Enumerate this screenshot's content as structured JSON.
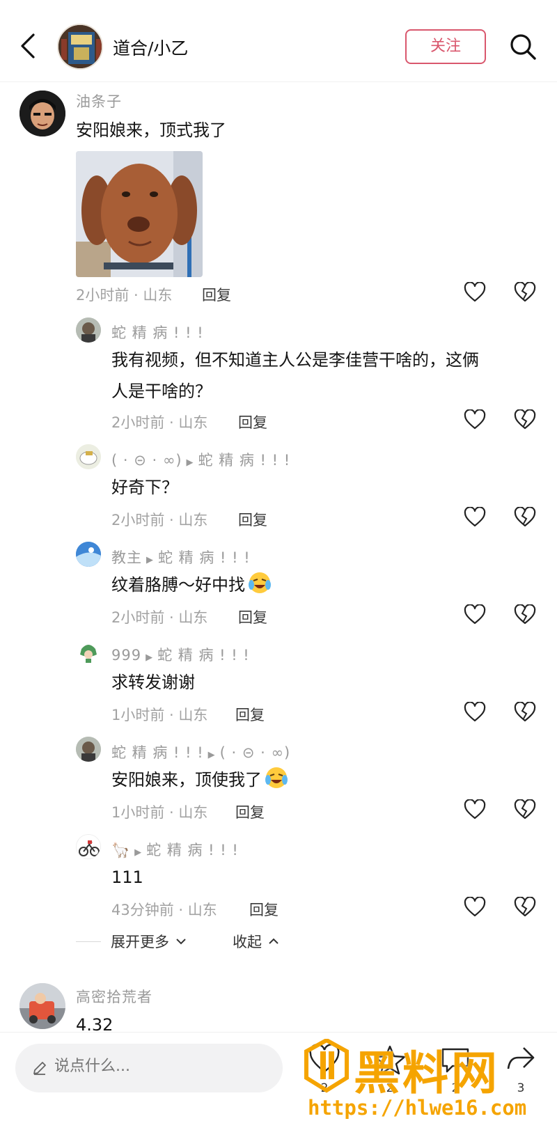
{
  "header": {
    "title": "道合/小乙",
    "follow_label": "关注"
  },
  "comments": [
    {
      "user": "油条子",
      "text": "安阳娘来，顶式我了",
      "time": "2小时前 · 山东",
      "reply": "回复"
    },
    {
      "user": "蛇 精 病 ! ! !",
      "text_line1": "我有视频，但不知道主人公是李佳营干啥的，这俩",
      "text_line2": "人是干啥的？",
      "time": "2小时前 · 山东",
      "reply": "回复"
    },
    {
      "user": "( · ⊝ · ∞)",
      "reply_to": "蛇 精 病 ! ! !",
      "text": "好奇下？",
      "time": "2小时前 · 山东",
      "reply": "回复"
    },
    {
      "user": "教主",
      "reply_to": "蛇 精 病 ! ! !",
      "text": "纹着胳膊～好中找",
      "time": "2小时前 · 山东",
      "reply": "回复"
    },
    {
      "user": "999",
      "reply_to": "蛇 精 病 ! ! !",
      "text": "求转发谢谢",
      "time": "1小时前 · 山东",
      "reply": "回复"
    },
    {
      "user": "蛇 精 病 ! ! !",
      "reply_to": "( · ⊝ · ∞)",
      "text": "安阳娘来，顶使我了",
      "time": "1小时前 · 山东",
      "reply": "回复"
    },
    {
      "user": "🦙",
      "reply_to": "蛇 精 病 ! ! !",
      "text": "111",
      "time": "43分钟前 · 山东",
      "reply": "回复"
    },
    {
      "user": "高密拾荒者",
      "text": "4.32"
    }
  ],
  "expand": {
    "more_label": "展开更多",
    "collapse_label": "收起"
  },
  "bottom": {
    "input_placeholder": "说点什么...",
    "counts": [
      "2",
      "2",
      "2",
      "3"
    ]
  },
  "watermark": {
    "title": "黑料网",
    "url": "https://hlwe16.com"
  },
  "icons": {
    "back": "chevron-left-icon",
    "search": "search-icon",
    "like": "heart-outline-icon",
    "dislike": "broken-heart-icon",
    "edit": "pencil-icon"
  },
  "colors": {
    "accent": "#d9576d",
    "watermark": "#f5a400",
    "meta_text": "#a2a2a2"
  }
}
